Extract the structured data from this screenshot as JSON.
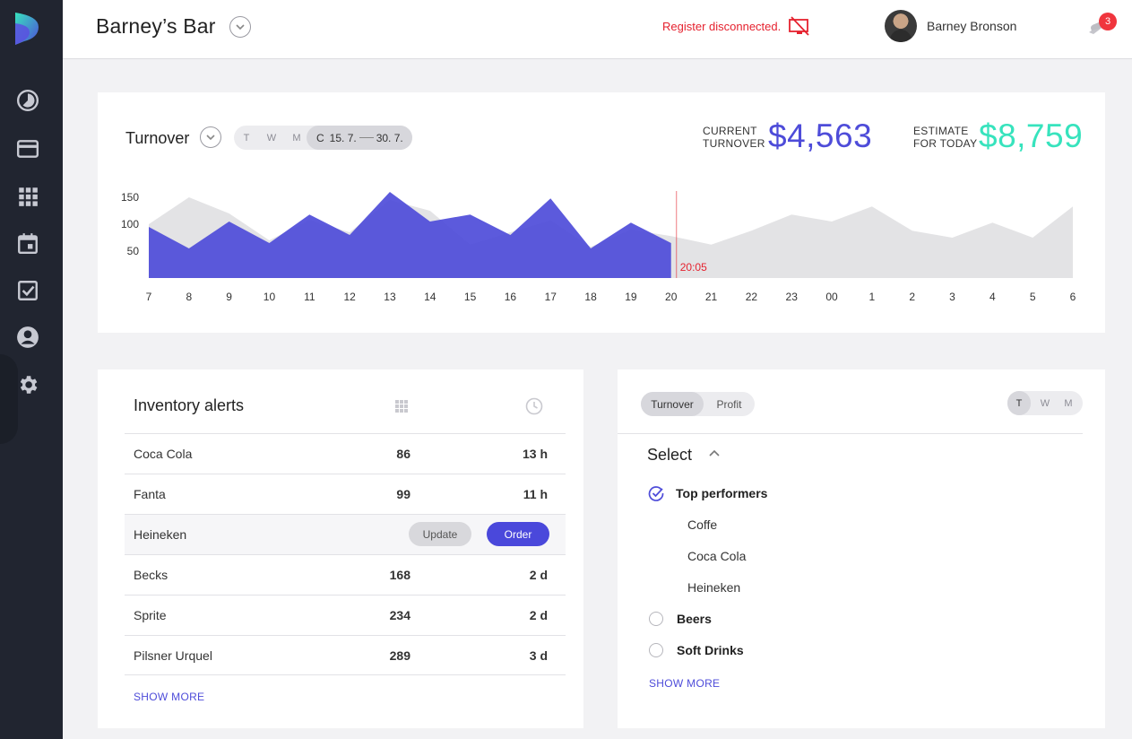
{
  "header": {
    "venue_name": "Barney’s Bar",
    "register_status": "Register disconnected.",
    "user_name": "Barney Bronson",
    "notification_count": "3"
  },
  "sidebar": {
    "items": [
      {
        "icon": "dashboard-icon"
      },
      {
        "icon": "card-icon"
      },
      {
        "icon": "grid-icon"
      },
      {
        "icon": "calendar-icon"
      },
      {
        "icon": "checkbox-icon"
      },
      {
        "icon": "account-icon"
      },
      {
        "icon": "settings-icon"
      }
    ]
  },
  "turnover": {
    "title": "Turnover",
    "range_options": [
      "T",
      "W",
      "M"
    ],
    "range_active_label": "C",
    "range_start": "15. 7.",
    "range_end": "30. 7.",
    "current_label_1": "CURRENT",
    "current_label_2": "TURNOVER",
    "current_value": "$4,563",
    "estimate_label_1": "ESTIMATE",
    "estimate_label_2": "FOR TODAY",
    "estimate_value": "$8,759"
  },
  "chart_data": {
    "type": "area",
    "x": [
      "7",
      "8",
      "9",
      "10",
      "11",
      "12",
      "13",
      "14",
      "15",
      "16",
      "17",
      "18",
      "19",
      "20",
      "21",
      "22",
      "23",
      "00",
      "1",
      "2",
      "3",
      "4",
      "5",
      "6"
    ],
    "yticks": [
      50,
      100,
      150
    ],
    "ylim": [
      0,
      160
    ],
    "series": [
      {
        "values": [
          95,
          55,
          105,
          65,
          118,
          80,
          160,
          105,
          118,
          80,
          148,
          55,
          103,
          65
        ],
        "color": "#4e4cd9"
      },
      {
        "values": [
          100,
          150,
          120,
          70,
          108,
          85,
          145,
          125,
          62,
          85,
          107,
          58,
          90,
          78,
          62,
          88,
          118,
          105,
          133,
          88,
          75,
          103,
          75,
          133
        ],
        "color": "#e3e3e5"
      }
    ],
    "marker_label": "20:05",
    "marker_color": "#e5222f"
  },
  "inventory": {
    "title": "Inventory alerts",
    "rows": [
      {
        "name": "Coca Cola",
        "qty": "86",
        "time": "13 h"
      },
      {
        "name": "Fanta",
        "qty": "99",
        "time": "11 h"
      },
      {
        "name": "Heineken",
        "update_label": "Update",
        "order_label": "Order"
      },
      {
        "name": "Becks",
        "qty": "168",
        "time": "2 d"
      },
      {
        "name": "Sprite",
        "qty": "234",
        "time": "2 d"
      },
      {
        "name": "Pilsner Urquel",
        "qty": "289",
        "time": "3 d"
      }
    ],
    "show_more": "SHOW MORE"
  },
  "selector": {
    "toggle_on": "Turnover",
    "toggle_off": "Profit",
    "periods": [
      "T",
      "W",
      "M"
    ],
    "title": "Select",
    "groups": [
      {
        "label": "Top performers",
        "checked": true,
        "items": [
          "Coffe",
          "Coca Cola",
          "Heineken"
        ]
      },
      {
        "label": "Beers",
        "checked": false
      },
      {
        "label": "Soft Drinks",
        "checked": false
      }
    ],
    "show_more": "SHOW MORE"
  }
}
